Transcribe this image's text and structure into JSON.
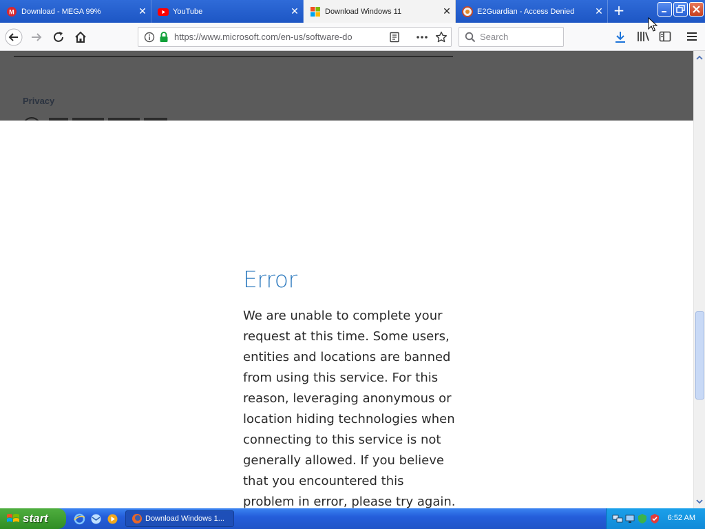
{
  "browser": {
    "tabs": [
      {
        "label": "Download - MEGA 99%",
        "icon": "mega-icon"
      },
      {
        "label": "YouTube",
        "icon": "youtube-icon"
      },
      {
        "label": "Download Windows 11",
        "icon": "windows-logo-icon",
        "active": true
      },
      {
        "label": "E2Guardian - Access Denied",
        "icon": "e2guardian-icon"
      }
    ],
    "url": "https://www.microsoft.com/en-us/software-do",
    "search_placeholder": "Search"
  },
  "page": {
    "overlay": {
      "privacy_label": "Privacy"
    },
    "error": {
      "title": "Error",
      "lines": [
        "We are unable to complete your",
        "request at this time. Some users,",
        "entities and locations are banned",
        "from using this service. For this",
        "reason, leveraging anonymous or",
        "location hiding technologies when",
        "connecting to this service is not",
        "generally allowed. If you believe",
        "that you encountered this",
        "problem in error, please try again."
      ]
    }
  },
  "taskbar": {
    "start_label": "start",
    "task_label": "Download Windows 1...",
    "clock": "6:52 AM"
  },
  "colors": {
    "titlebar": "#245edb",
    "error_title": "#2f7bbf",
    "overlay": "#5b5b5b",
    "start_green": "#3a9a2e"
  }
}
